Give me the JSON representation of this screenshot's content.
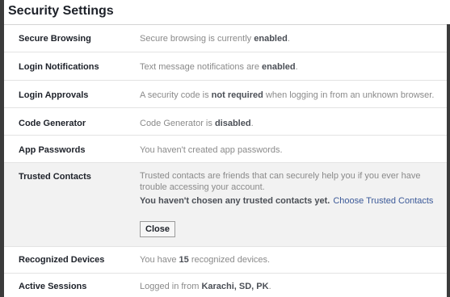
{
  "title": "Security Settings",
  "rows": {
    "secure_browsing": {
      "label": "Secure Browsing",
      "pre": "Secure browsing is currently ",
      "strong": "enabled",
      "post": "."
    },
    "login_notifications": {
      "label": "Login Notifications",
      "pre": "Text message notifications are ",
      "strong": "enabled",
      "post": "."
    },
    "login_approvals": {
      "label": "Login Approvals",
      "pre": "A security code is ",
      "strong": "not required",
      "post": " when logging in from an unknown browser."
    },
    "code_generator": {
      "label": "Code Generator",
      "pre": "Code Generator is ",
      "strong": "disabled",
      "post": "."
    },
    "app_passwords": {
      "label": "App Passwords",
      "text": "You haven't created app passwords."
    },
    "trusted_contacts": {
      "label": "Trusted Contacts",
      "description": "Trusted contacts are friends that can securely help you if you ever have trouble accessing your account.",
      "none_chosen": "You haven't chosen any trusted contacts yet.",
      "choose_link": "Choose Trusted Contacts",
      "close_button": "Close"
    },
    "recognized_devices": {
      "label": "Recognized Devices",
      "pre": "You have ",
      "strong": "15",
      "post": " recognized devices."
    },
    "active_sessions": {
      "label": "Active Sessions",
      "pre": "Logged in from ",
      "strong": "Karachi, SD, PK",
      "post": "."
    }
  },
  "colors": {
    "link": "#3b5998",
    "expanded_background": "#f2f2f2",
    "frame_border": "#3b3b3b"
  }
}
